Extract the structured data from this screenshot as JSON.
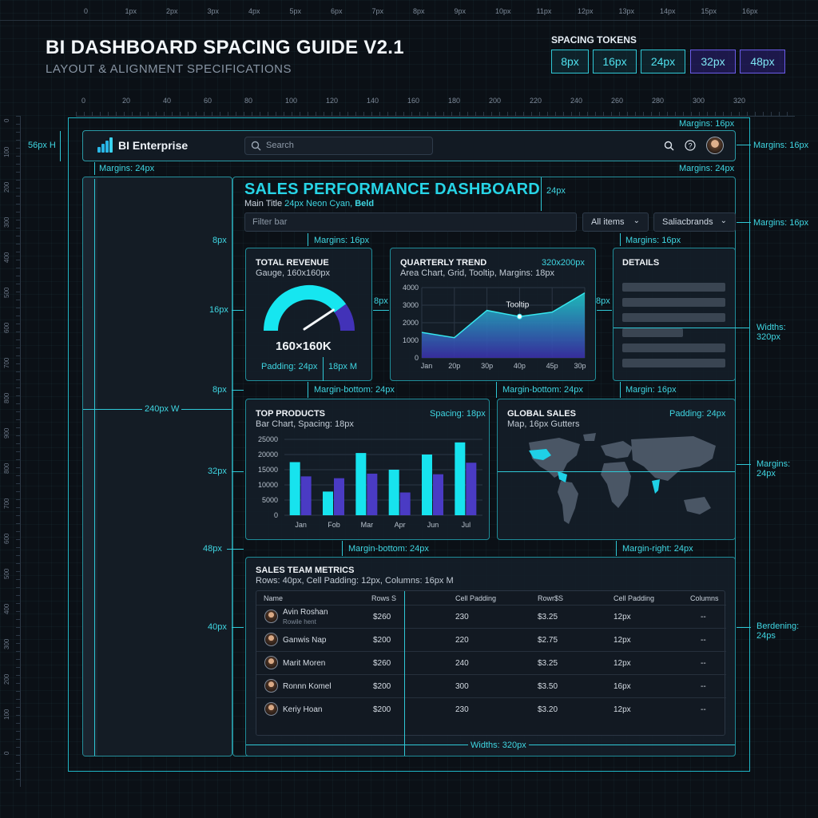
{
  "top_ruler": [
    "0",
    "1px",
    "2px",
    "3px",
    "4px",
    "5px",
    "6px",
    "7px",
    "8px",
    "9px",
    "10px",
    "11px",
    "12px",
    "13px",
    "14px",
    "15px",
    "16px"
  ],
  "ruler_h": [
    "0",
    "20",
    "40",
    "60",
    "80",
    "100",
    "120",
    "140",
    "160",
    "180",
    "200",
    "220",
    "240",
    "260",
    "280",
    "300",
    "320"
  ],
  "ruler_v": [
    "0",
    "100",
    "200",
    "300",
    "400",
    "500",
    "600",
    "700",
    "800",
    "900",
    "800",
    "700",
    "600",
    "500",
    "400",
    "300",
    "200",
    "100",
    "0"
  ],
  "guide": {
    "title": "BI DASHBOARD SPACING GUIDE V2.1",
    "subtitle": "LAYOUT & ALIGNMENT SPECIFICATIONS",
    "tokens_label": "SPACING TOKENS",
    "tokens": [
      "8px",
      "16px",
      "24px",
      "32px",
      "48px"
    ]
  },
  "header": {
    "brand": "BI Enterprise",
    "search_placeholder": "Search",
    "search_icon": "search-icon",
    "help_icon": "help-icon"
  },
  "annotations": {
    "header_height": "56px H",
    "margins_16_top": "Margins: 16px",
    "margins_16_right": "Margins: 16px",
    "margins_24_left": "Margins: 24px",
    "margins_24_right": "Margins: 24px",
    "title_gap": "24px",
    "filter_margins": "Margins: 16px",
    "filter_margins_top": "Margins: 16px",
    "details_margins": "Margins: 16px",
    "side_8px": "8px",
    "side_16px": "16px",
    "side_8px_b": "8px",
    "side_32px": "32px",
    "side_48px": "48px",
    "side_40px": "40px",
    "sidebar_width": "240px W",
    "gap_8px_a": "8px",
    "gap_8px_b": "8px",
    "mb_24_a": "Margin-bottom: 24px",
    "mb_24_b": "Margin-bottom: 24px",
    "margin_16_c": "Margin: 16px",
    "mb_24_c": "Margin-bottom: 24px",
    "mr_24": "Margin-right: 24px",
    "widths_320": "Widths:\n320px",
    "margins_24_map": "Margins:\n24px",
    "bordering": "Berdening:\n24ps",
    "bottom_width": "Widths: 320px"
  },
  "dashboard": {
    "title": "SALES PERFORMANCE DASHBOARD",
    "subtitle_prefix": "Main Title ",
    "subtitle_cyan": "24px Neon Cyan, ",
    "subtitle_bold": "Beld",
    "filter_placeholder": "Filter bar",
    "select_1": "All items",
    "select_2": "Saliacbrands"
  },
  "cards": {
    "revenue": {
      "title": "TOTAL REVENUE",
      "sub": "Gauge, 160x160px",
      "value": "160×160K",
      "padding": "Padding: 24px",
      "side_note": "18px M",
      "level": 0.8
    },
    "trend": {
      "title": "QUARTERLY TREND",
      "size": "320x200px",
      "sub": "Area Chart, Grid, Tooltip, Margins: 18px",
      "tooltip": "Tooltip"
    },
    "details": {
      "title": "DETAILS"
    },
    "products": {
      "title": "TOP PRODUCTS",
      "spacing": "Spacing: 18px",
      "sub": "Bar Chart, Spacing: 18px"
    },
    "global": {
      "title": "GLOBAL SALES",
      "padding": "Padding: 24px",
      "sub": "Map, 16px Gutters"
    },
    "team": {
      "title": "SALES TEAM METRICS",
      "sub": "Rows: 40px, Cell Padding: 12px, Columns: 16px M"
    }
  },
  "chart_data": [
    {
      "type": "area",
      "x": [
        "Jan",
        "20p",
        "30p",
        "40p",
        "45p",
        "30p"
      ],
      "y": [
        1450,
        1150,
        2700,
        2350,
        2600,
        3700
      ],
      "yticks": [
        "0",
        "1000",
        "2000",
        "3000",
        "4000"
      ],
      "ylim": [
        0,
        4000
      ],
      "colors": {
        "fill_top": "#1fc9c9",
        "fill_bottom": "#3a2fa8",
        "line": "#36e6ee"
      }
    },
    {
      "type": "bar",
      "categories": [
        "Jan",
        "Fob",
        "Mar",
        "Apr",
        "Jun",
        "Jul"
      ],
      "series": [
        {
          "values": [
            17500,
            7800,
            20500,
            15000,
            20000,
            24000
          ]
        },
        {
          "values": [
            12800,
            12200,
            13700,
            7500,
            13500,
            17300
          ]
        }
      ],
      "yticks": [
        "0",
        "5000",
        "10000",
        "15000",
        "20000",
        "25000"
      ],
      "ylim": [
        0,
        25000
      ],
      "colors": {
        "s1": "#17e3ee",
        "s2": "#4a3bc4"
      }
    }
  ],
  "table": {
    "headers": [
      "Name",
      "Rows S",
      "Cell Padding",
      "Rowr$S",
      "Cell Padding",
      "Columns"
    ],
    "rows": [
      {
        "name": "Avin Roshan",
        "sub": "Rowile hent",
        "a": "$260",
        "b": "230",
        "c": "$3.25",
        "d": "12px",
        "e": "--"
      },
      {
        "name": "Ganwis Nap",
        "sub": "",
        "a": "$200",
        "b": "220",
        "c": "$2.75",
        "d": "12px",
        "e": "--"
      },
      {
        "name": "Marit Moren",
        "sub": "",
        "a": "$260",
        "b": "240",
        "c": "$3.25",
        "d": "12px",
        "e": "--"
      },
      {
        "name": "Ronnn Komel",
        "sub": "",
        "a": "$200",
        "b": "300",
        "c": "$3.50",
        "d": "16px",
        "e": "--"
      },
      {
        "name": "Keriy Hoan",
        "sub": "",
        "a": "$200",
        "b": "230",
        "c": "$3.20",
        "d": "12px",
        "e": "--"
      }
    ]
  }
}
